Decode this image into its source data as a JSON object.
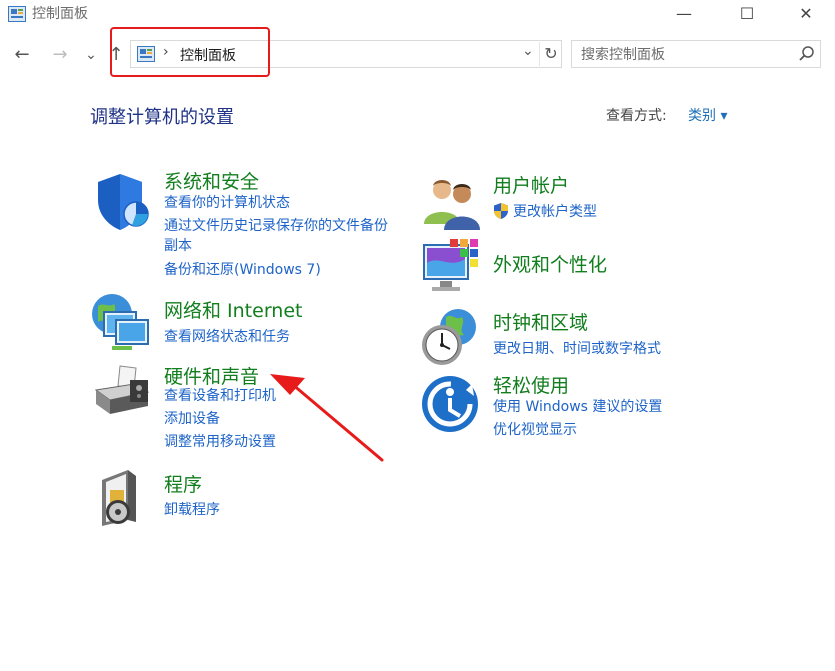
{
  "window": {
    "title": "控制面板",
    "controls": {
      "minimize": "—",
      "maximize": "☐",
      "close": "✕"
    }
  },
  "nav": {
    "back": "←",
    "forward": "→",
    "recent": "⌄",
    "up": "↑",
    "address": {
      "separator": "›",
      "path": "控制面板",
      "dropdown": "⌄",
      "refresh": "↻"
    },
    "search_placeholder": "搜索控制面板"
  },
  "content": {
    "title": "调整计算机的设置",
    "view_by_label": "查看方式:",
    "view_by_value": "类别 ▾",
    "left_categories": [
      {
        "title": "系统和安全",
        "links": [
          "查看你的计算机状态",
          "通过文件历史记录保存你的文件备份",
          "副本",
          "备份和还原(Windows 7)"
        ]
      },
      {
        "title": "网络和 Internet",
        "links": [
          "查看网络状态和任务"
        ]
      },
      {
        "title": "硬件和声音",
        "links": [
          "查看设备和打印机",
          "添加设备",
          "调整常用移动设置"
        ]
      },
      {
        "title": "程序",
        "links": [
          "卸载程序"
        ]
      }
    ],
    "right_categories": [
      {
        "title": "用户帐户",
        "links": [
          "更改帐户类型"
        ]
      },
      {
        "title": "外观和个性化",
        "links": []
      },
      {
        "title": "时钟和区域",
        "links": [
          "更改日期、时间或数字格式"
        ]
      },
      {
        "title": "轻松使用",
        "links": [
          "使用 Windows 建议的设置",
          "优化视觉显示"
        ]
      }
    ]
  },
  "colors": {
    "category_title": "#127e1e",
    "link": "#1e64c8",
    "page_title": "#1e3287",
    "annotation": "#e81b1b"
  }
}
